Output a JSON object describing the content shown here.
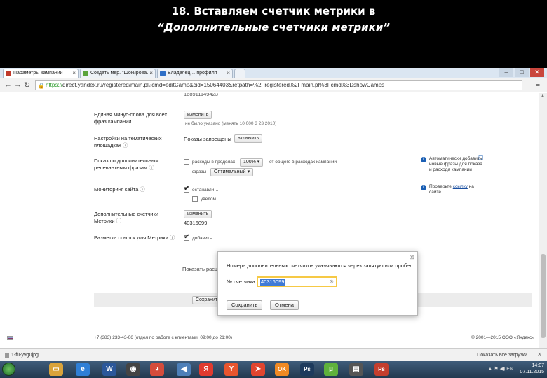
{
  "slide": {
    "title_line1": "18. Вставляем счетчик метрики в",
    "title_line2": "“Дополнительные счетчики метрики”"
  },
  "browser": {
    "tabs": [
      {
        "label": "Параметры кампании",
        "icon_color": "#c0392b"
      },
      {
        "label": "Создать мер. \"Шокирова…",
        "icon_color": "#5ba33b"
      },
      {
        "label": "Владелец… профиля",
        "icon_color": "#2f6fc7"
      }
    ],
    "url_https": "https://",
    "url_rest": "direct.yandex.ru/registered/main.pl?cmd=editCamp&cid=15064403&retpath=%2Fregistered%2Fmain.pl%3Fcmd%3DshowCamps"
  },
  "form": {
    "top_value": "168911149423",
    "row1": {
      "label": "Единая минус-слова для всех фраз кампании",
      "button": "изменить",
      "note": "не было указано (менять 10 000 3 23 2010)"
    },
    "row2": {
      "label": "Настройки на тематических площадках",
      "value": "Показы запрещены",
      "button": "включить"
    },
    "row3": {
      "label": "Показ по дополнительным релевантным фразам",
      "checkbox_text": "расходы в пределах",
      "select_value": "100%",
      "tail_text": "от общего в расходах кампании",
      "line2_prefix": "фразы",
      "select2_value": "Оптимальный"
    },
    "row4": {
      "label": "Мониторинг сайта",
      "cb1_text": "останавли…",
      "cb2_text": "уведом…"
    },
    "row5": {
      "label": "Дополнительные счетчики Метрики",
      "button": "изменить",
      "value": "40316099"
    },
    "row6": {
      "label": "Разметка ссылок для Метрики",
      "cb_text": "добавить …"
    },
    "show_extra_link": "Показать расширенные настройки",
    "save_button": "Сохранить",
    "side_note1": "Автоматически добавить новые фразы для показа и расхода кампании",
    "side_note2_prefix": "Проверьте",
    "side_note2_link": "ссылку",
    "side_note2_suffix": "на сайте."
  },
  "modal": {
    "title": "Номера дополнительных счетчиков указываются через запятую или пробел",
    "field_label": "№ счетчика:",
    "field_value": "40316099",
    "save_label": "Сохранить",
    "cancel_label": "Отмена"
  },
  "footer": {
    "left": "+7 (383) 233-43-06 (отдел по работе с клиентами, 09:00 до 21:00)",
    "right": "© 2001—2015 ООО «Яндекс»"
  },
  "downloads": {
    "item": "1-fu-y9g0jpg",
    "right_text": "Показать все загрузки"
  },
  "taskbar": {
    "time": "14:07",
    "date": "07.11.2015",
    "lang": "EN",
    "icons": [
      {
        "name": "explorer-icon",
        "glyph": "▭",
        "color": "#d9a33b"
      },
      {
        "name": "ie-icon",
        "glyph": "e",
        "color": "#2f7fd6"
      },
      {
        "name": "word-icon",
        "glyph": "W",
        "color": "#2b579a"
      },
      {
        "name": "camera-icon",
        "glyph": "◉",
        "color": "#444"
      },
      {
        "name": "chrome-icon",
        "glyph": "◕",
        "color": "#d44c3c"
      },
      {
        "name": "speaker-icon",
        "glyph": "◀",
        "color": "#4d7fb8"
      },
      {
        "name": "yandex-icon",
        "glyph": "Я",
        "color": "#e03a2f"
      },
      {
        "name": "yandex-browser-icon",
        "glyph": "Y",
        "color": "#e8552f"
      },
      {
        "name": "arrow-icon",
        "glyph": "➤",
        "color": "#e0452f"
      },
      {
        "name": "ok-icon",
        "glyph": "OK",
        "color": "#f08a24"
      },
      {
        "name": "photoshop-icon",
        "glyph": "Ps",
        "color": "#1d3a5c"
      },
      {
        "name": "utorrent-icon",
        "glyph": "µ",
        "color": "#5fb13c"
      },
      {
        "name": "film-icon",
        "glyph": "▤",
        "color": "#555"
      },
      {
        "name": "photoshop2-icon",
        "glyph": "Ps",
        "color": "#c43e2e"
      }
    ]
  }
}
